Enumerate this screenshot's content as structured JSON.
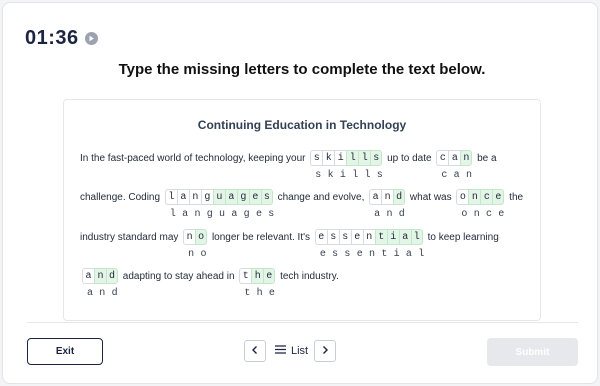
{
  "timer": {
    "value": "01:36",
    "control_icon": "play-icon"
  },
  "instructions": "Type the missing letters to complete the text below.",
  "passage": {
    "title": "Continuing Education in Technology",
    "lines": [
      {
        "segments": [
          {
            "text": "In the fast-paced world of technology, keeping your "
          },
          {
            "gap": [
              [
                "s",
                0
              ],
              [
                "k",
                0
              ],
              [
                "i",
                0
              ],
              [
                "l",
                1
              ],
              [
                "l",
                1
              ],
              [
                "s",
                1
              ]
            ],
            "answer": "skills"
          },
          {
            "text": " up to date "
          },
          {
            "gap": [
              [
                "c",
                0
              ],
              [
                "a",
                0
              ],
              [
                "n",
                1
              ]
            ],
            "answer": "can"
          },
          {
            "text": " be a"
          }
        ]
      },
      {
        "segments": [
          {
            "text": "challenge. Coding "
          },
          {
            "gap": [
              [
                "l",
                0
              ],
              [
                "a",
                0
              ],
              [
                "n",
                0
              ],
              [
                "g",
                0
              ],
              [
                "u",
                1
              ],
              [
                "a",
                1
              ],
              [
                "g",
                1
              ],
              [
                "e",
                1
              ],
              [
                "s",
                1
              ]
            ],
            "answer": "languages"
          },
          {
            "text": " change and evolve, "
          },
          {
            "gap": [
              [
                "a",
                0
              ],
              [
                "n",
                0
              ],
              [
                "d",
                1
              ]
            ],
            "answer": "and"
          },
          {
            "text": " what was "
          },
          {
            "gap": [
              [
                "o",
                0
              ],
              [
                "n",
                1
              ],
              [
                "c",
                1
              ],
              [
                "e",
                1
              ]
            ],
            "answer": "once"
          },
          {
            "text": " the"
          }
        ]
      },
      {
        "segments": [
          {
            "text": "industry standard may "
          },
          {
            "gap": [
              [
                "n",
                0
              ],
              [
                "o",
                1
              ]
            ],
            "answer": "no"
          },
          {
            "text": " longer be relevant. It's "
          },
          {
            "gap": [
              [
                "e",
                0
              ],
              [
                "s",
                0
              ],
              [
                "s",
                0
              ],
              [
                "e",
                0
              ],
              [
                "n",
                0
              ],
              [
                "t",
                1
              ],
              [
                "i",
                1
              ],
              [
                "a",
                1
              ],
              [
                "l",
                1
              ]
            ],
            "answer": "essential"
          },
          {
            "text": " to keep learning"
          }
        ]
      },
      {
        "segments": [
          {
            "gap": [
              [
                "a",
                0
              ],
              [
                "n",
                1
              ],
              [
                "d",
                1
              ]
            ],
            "answer": "and"
          },
          {
            "text": " adapting to stay ahead in "
          },
          {
            "gap": [
              [
                "t",
                0
              ],
              [
                "h",
                1
              ],
              [
                "e",
                1
              ]
            ],
            "answer": "the"
          },
          {
            "text": " tech industry."
          }
        ]
      }
    ]
  },
  "footer": {
    "exit_label": "Exit",
    "list_label": "List",
    "submit_label": "Submit",
    "prev_icon": "chevron-left-icon",
    "next_icon": "chevron-right-icon",
    "list_icon": "list-icon"
  }
}
